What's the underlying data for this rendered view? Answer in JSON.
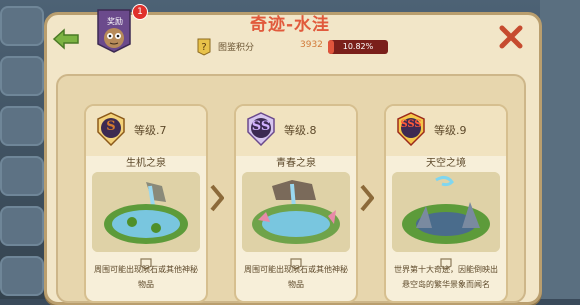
{
  "header": {
    "title": "奇迹-水洼",
    "badge_label": "奖励",
    "notification_count": "1",
    "progress_label": "图鉴积分",
    "progress_count": "3932",
    "progress_text": "10.82%",
    "progress_value": 0.1082
  },
  "cards": [
    {
      "rank": "S",
      "level": "等级.7",
      "name": "生机之泉",
      "desc": "周围可能出现陨石或其他神秘物品",
      "emblem_color": "#d37a2f"
    },
    {
      "rank": "SS",
      "level": "等级.8",
      "name": "青春之泉",
      "desc": "周围可能出现陨石或其他神秘物品",
      "emblem_color": "#8a5bb7"
    },
    {
      "rank": "SSS",
      "level": "等级.9",
      "name": "天空之境",
      "desc": "世界第十大奇迹，因能倒映出悬空岛的繁华景象而闻名",
      "emblem_color": "#c0392b"
    }
  ],
  "icons": {
    "back": "back-arrow-icon",
    "close": "close-icon",
    "hint": "hint-icon"
  },
  "colors": {
    "title": "#e15a3c",
    "panel": "#f2e6c8",
    "progress_fill": "#e0553c"
  }
}
